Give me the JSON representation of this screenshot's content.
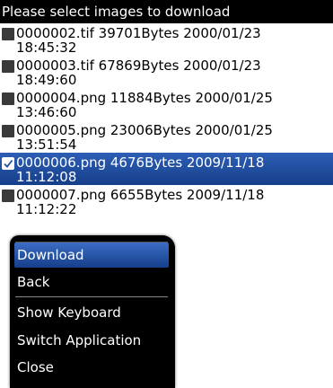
{
  "header": {
    "title": "Please select images to download"
  },
  "files": [
    {
      "line1": "0000002.tif 39701Bytes 2000/01/23",
      "line2": "18:45:32",
      "checked": false
    },
    {
      "line1": "0000003.tif 67869Bytes 2000/01/23",
      "line2": "18:49:60",
      "checked": false
    },
    {
      "line1": "0000004.png 11884Bytes 2000/01/25",
      "line2": "13:46:60",
      "checked": false
    },
    {
      "line1": "0000005.png 23006Bytes 2000/01/25",
      "line2": "13:51:54",
      "checked": false
    },
    {
      "line1": "0000006.png 4676Bytes 2009/11/18",
      "line2": "11:12:08",
      "checked": true
    },
    {
      "line1": "0000007.png 6655Bytes 2009/11/18",
      "line2": "11:12:22",
      "checked": false
    }
  ],
  "menu": {
    "items": [
      {
        "label": "Download"
      },
      {
        "label": "Back"
      },
      {
        "label": "Show Keyboard"
      },
      {
        "label": "Switch Application"
      },
      {
        "label": "Close"
      }
    ]
  },
  "colors": {
    "selection": "#1f4fa0",
    "menu_background": "#000000"
  }
}
